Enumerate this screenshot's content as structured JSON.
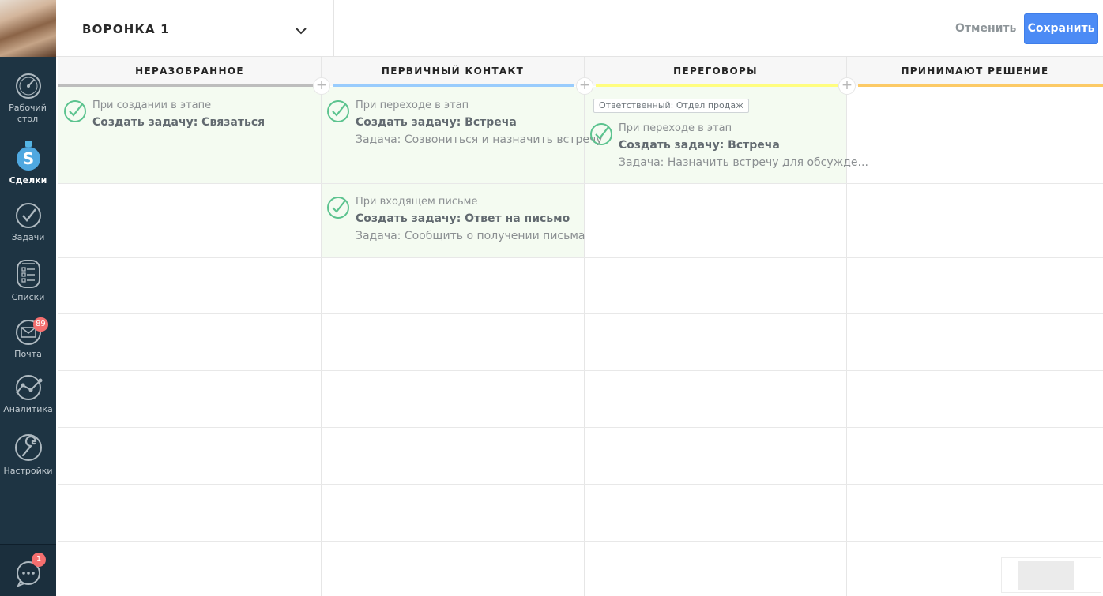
{
  "sidebar": {
    "items": [
      {
        "label": "Рабочий стол",
        "icon": "dashboard-icon"
      },
      {
        "label": "Сделки",
        "icon": "deals-icon"
      },
      {
        "label": "Задачи",
        "icon": "tasks-icon"
      },
      {
        "label": "Списки",
        "icon": "lists-icon"
      },
      {
        "label": "Почта",
        "icon": "mail-icon",
        "badge": "89"
      },
      {
        "label": "Аналитика",
        "icon": "analytics-icon"
      },
      {
        "label": "Настройки",
        "icon": "settings-icon"
      }
    ],
    "chat_badge": "1"
  },
  "header": {
    "pipeline_name": "ВОРОНКА 1",
    "cancel_label": "Отменить",
    "save_label": "Сохранить"
  },
  "columns": [
    {
      "title": "НЕРАЗОБРАННОЕ",
      "color": "#bdbdbd"
    },
    {
      "title": "ПЕРВИЧНЫЙ КОНТАКТ",
      "color": "#99ccfd"
    },
    {
      "title": "ПЕРЕГОВОРЫ",
      "color": "#fffd7f"
    },
    {
      "title": "ПРИНИМАЮТ РЕШЕНИЕ",
      "color": "#fcca66"
    }
  ],
  "triggers": [
    {
      "when": "При создании в этапе",
      "action": "Создать задачу: Связаться",
      "task": ""
    },
    {
      "when": "При переходе в этап",
      "action": "Создать задачу: Встреча",
      "task": "Задача: Созвониться и назначить встречу"
    },
    {
      "when": "При переходе в этап",
      "action": "Создать задачу: Встреча",
      "task": "Задача: Назначить встречу для обсужде..."
    },
    {
      "when": "При входящем письме",
      "action": "Создать задачу: Ответ на письмо",
      "task": "Задача: Сообщить о получении письма"
    }
  ],
  "responsible_tag": "Ответственный: Отдел продаж",
  "colors": {
    "accent": "#4c8bf5",
    "sidebar": "#1e3443",
    "check": "#5cc38f",
    "badge": "#f56f6f",
    "cell_highlight": "#f4fbf1"
  }
}
